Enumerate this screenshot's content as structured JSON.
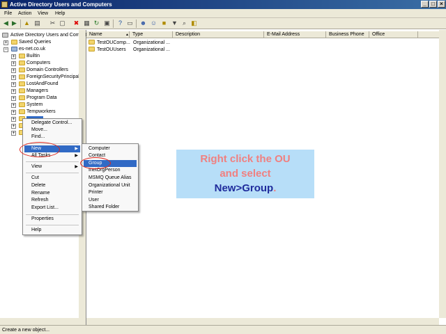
{
  "window": {
    "title": "Active Directory Users and Computers"
  },
  "menubar": [
    "File",
    "Action",
    "View",
    "Help"
  ],
  "toolbar_icons": [
    "back-arrow-icon",
    "forward-arrow-icon",
    "up-folder-icon",
    "show-hide-tree-icon",
    "cut-icon",
    "copy-icon",
    "delete-icon",
    "properties-icon",
    "refresh-icon",
    "export-icon",
    "help-icon",
    "console-icon",
    "new-user-icon",
    "new-group-icon",
    "new-ou-icon",
    "filter-icon",
    "find-icon",
    "add-to-group-icon"
  ],
  "tree": {
    "root": "Active Directory Users and Comput",
    "saved_queries": "Saved Queries",
    "domain": "es-net.co.uk",
    "children": [
      "Builtin",
      "Computers",
      "Domain Controllers",
      "ForeignSecurityPrincipals",
      "LostAndFound",
      "Managers",
      "Program Data",
      "System",
      "Tempworkers"
    ]
  },
  "list": {
    "columns": [
      "Name",
      "Type",
      "Description",
      "E-Mail Address",
      "Business Phone",
      "Office"
    ],
    "rows": [
      {
        "name": "TestOUComp...",
        "type": "Organizational ..."
      },
      {
        "name": "TestOUUsers",
        "type": "Organizational ..."
      }
    ]
  },
  "context_menu": {
    "delegate": "Delegate Control...",
    "move": "Move...",
    "find": "Find...",
    "new": "New",
    "all_tasks": "All Tasks",
    "view": "View",
    "cut": "Cut",
    "delete": "Delete",
    "rename": "Rename",
    "refresh": "Refresh",
    "export": "Export List...",
    "properties": "Properties",
    "help": "Help"
  },
  "submenu": [
    "Computer",
    "Contact",
    "Group",
    "InetOrgPerson",
    "MSMQ Queue Alias",
    "Organizational Unit",
    "Printer",
    "User",
    "Shared Folder"
  ],
  "callout": {
    "line1": "Right click the OU",
    "line2": "and select",
    "line3": "New>Group",
    "line4": "."
  },
  "status": "Create a new object...",
  "colors": {
    "titlebar": "#0a246a",
    "highlight": "#316ac5",
    "callout_bg": "#b7def8",
    "callout_pink": "#f08080",
    "callout_navy": "#1f2c9c",
    "ring": "#e0241b"
  }
}
